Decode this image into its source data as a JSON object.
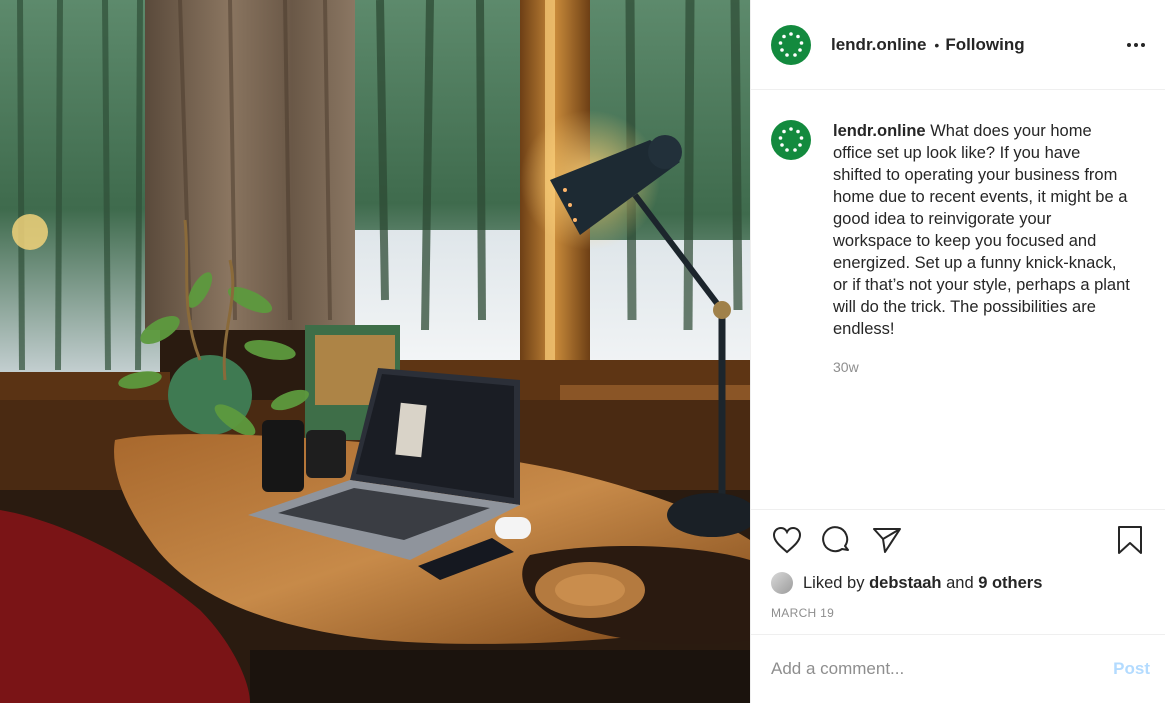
{
  "post": {
    "username": "lendr.online",
    "follow_separator": "•",
    "follow_status": "Following",
    "caption": "What does your home office set up look like? If you have shifted to operating your business from home due to recent events, it might be a good idea to reinvigorate your workspace to keep you focused and energized. Set up a funny knick-knack, or if that’s not your style, perhaps a plant will do the trick. The possibilities are endless!",
    "age": "30w",
    "liked_by_prefix": "Liked by",
    "liked_by_user": "debstaah",
    "liked_by_joiner": "and",
    "liked_by_others": "9 others",
    "date": "MARCH 19",
    "avatar_color": "#138a3e"
  },
  "comment": {
    "placeholder": "Add a comment...",
    "post_label": "Post",
    "post_color": "#b3dbff"
  },
  "icons": {
    "more": "more-options-icon",
    "like": "heart-icon",
    "comment": "comment-bubble-icon",
    "share": "paper-plane-icon",
    "save": "bookmark-icon"
  },
  "photo": {
    "alt": "home office desk with laptop, plants and a black desk lamp by a window"
  }
}
